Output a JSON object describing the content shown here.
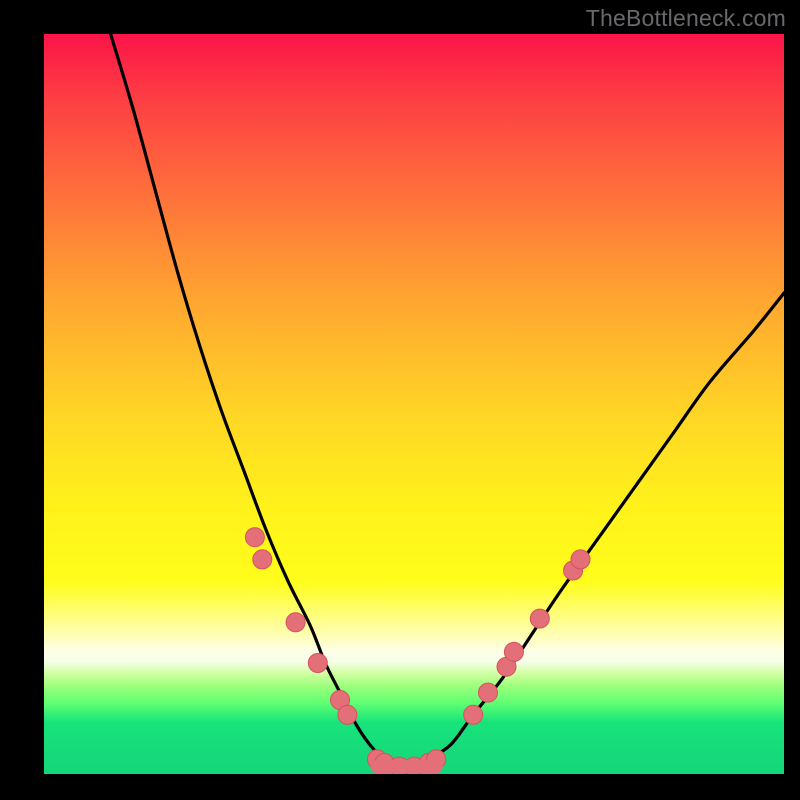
{
  "watermark": "TheBottleneck.com",
  "colors": {
    "curve": "#000000",
    "marker_fill": "#e37078",
    "marker_stroke": "#d94f5b",
    "gradient_top": "#fc1449",
    "gradient_mid": "#fff21b",
    "gradient_light": "#fdffe8",
    "gradient_green": "#15d97a",
    "frame": "#000000"
  },
  "chart_data": {
    "type": "line",
    "title": "",
    "xlabel": "",
    "ylabel": "",
    "xlim": [
      0,
      100
    ],
    "ylim": [
      0,
      100
    ],
    "grid": false,
    "series": [
      {
        "name": "bottleneck-curve",
        "x": [
          9,
          12,
          15,
          18,
          21,
          24,
          27,
          30,
          33,
          36,
          38,
          40,
          42,
          44,
          46,
          48,
          50,
          52,
          55,
          58,
          62,
          66,
          70,
          75,
          80,
          85,
          90,
          96,
          100
        ],
        "y": [
          100,
          90,
          79,
          68,
          58,
          49,
          41,
          33,
          26,
          20,
          15,
          11,
          7,
          4,
          2,
          1,
          1,
          2,
          4,
          8,
          13,
          19,
          25,
          32,
          39,
          46,
          53,
          60,
          65
        ]
      }
    ],
    "markers": [
      {
        "x": 28.5,
        "y": 32.0
      },
      {
        "x": 29.5,
        "y": 29.0
      },
      {
        "x": 34.0,
        "y": 20.5
      },
      {
        "x": 37.0,
        "y": 15.0
      },
      {
        "x": 40.0,
        "y": 10.0
      },
      {
        "x": 41.0,
        "y": 8.0
      },
      {
        "x": 45.0,
        "y": 2.0
      },
      {
        "x": 46.0,
        "y": 1.5
      },
      {
        "x": 48.0,
        "y": 1.0
      },
      {
        "x": 50.0,
        "y": 1.0
      },
      {
        "x": 52.0,
        "y": 1.5
      },
      {
        "x": 53.0,
        "y": 2.0
      },
      {
        "x": 58.0,
        "y": 8.0
      },
      {
        "x": 60.0,
        "y": 11.0
      },
      {
        "x": 62.5,
        "y": 14.5
      },
      {
        "x": 63.5,
        "y": 16.5
      },
      {
        "x": 67.0,
        "y": 21.0
      },
      {
        "x": 71.5,
        "y": 27.5
      },
      {
        "x": 72.5,
        "y": 29.0
      }
    ]
  }
}
